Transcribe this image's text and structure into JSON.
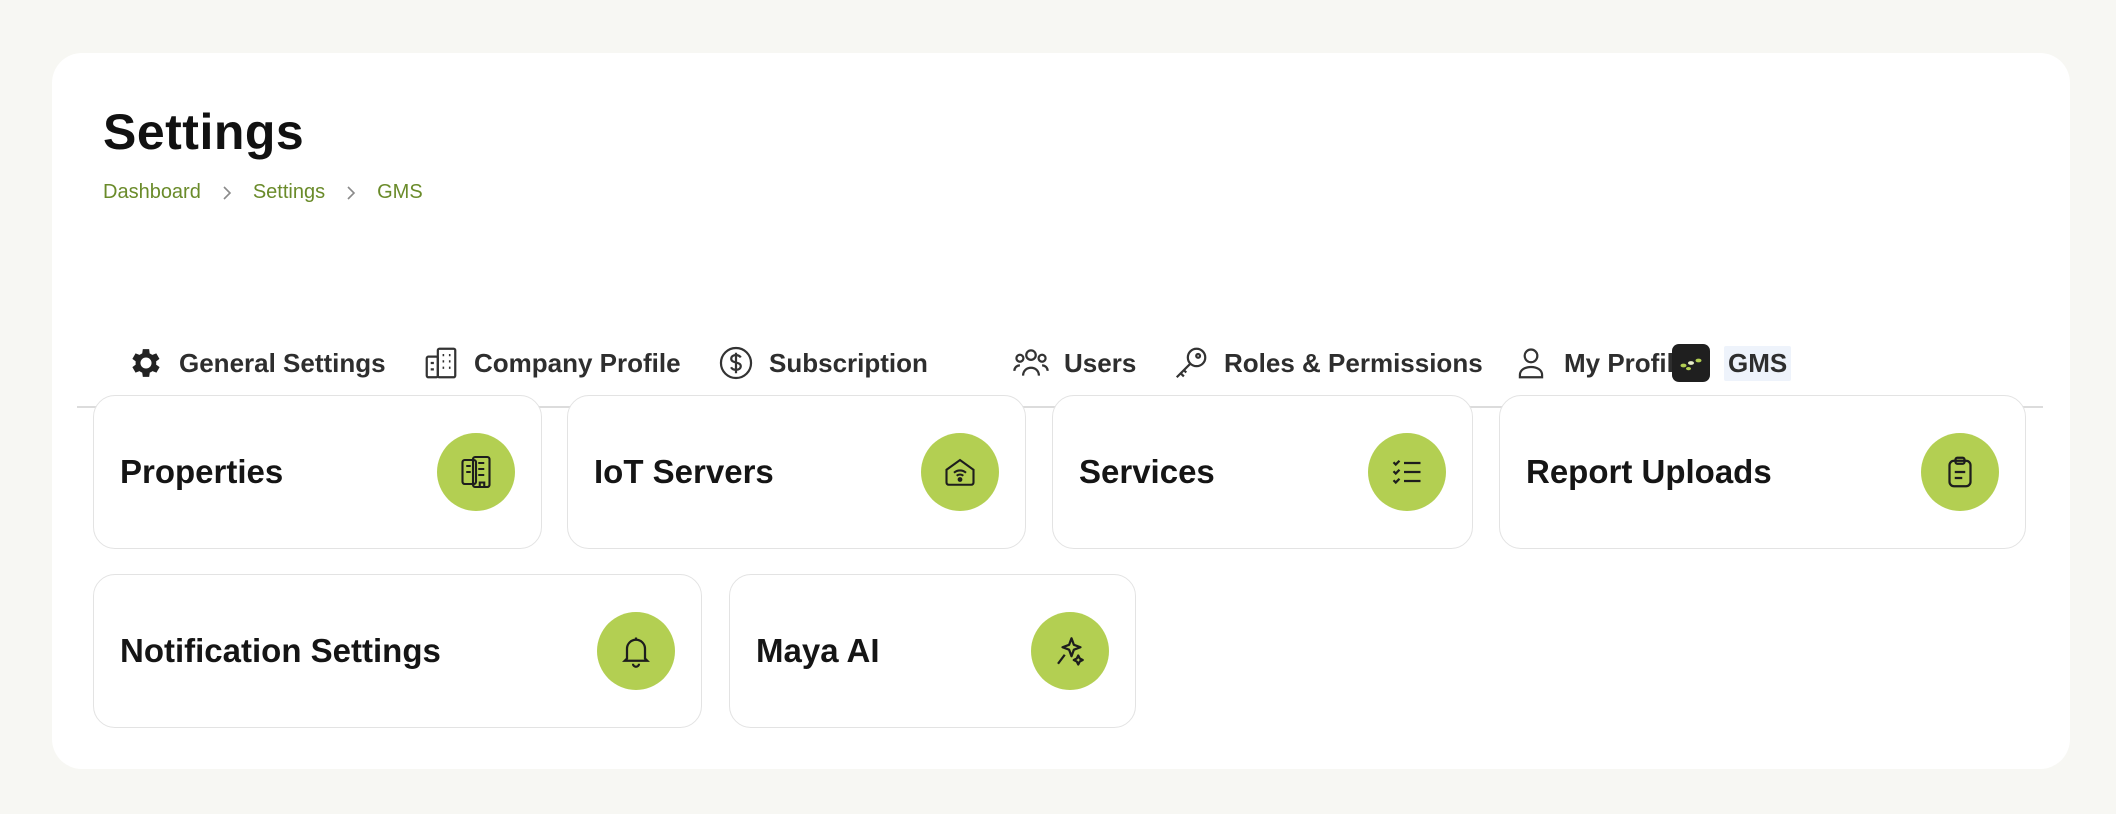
{
  "header": {
    "title": "Settings",
    "breadcrumb": [
      "Dashboard",
      "Settings",
      "GMS"
    ]
  },
  "tabs": [
    {
      "label": "General Settings",
      "icon": "gear-icon"
    },
    {
      "label": "Company Profile",
      "icon": "building-icon"
    },
    {
      "label": "Subscription",
      "icon": "dollar-circle-icon"
    },
    {
      "label": "Users",
      "icon": "users-icon"
    },
    {
      "label": "Roles & Permissions",
      "icon": "key-icon"
    },
    {
      "label": "My Profile",
      "icon": "user-icon"
    },
    {
      "label": "GMS",
      "icon": "gms-logo-icon",
      "active": true
    }
  ],
  "cards": [
    {
      "label": "Properties",
      "icon": "buildings-icon"
    },
    {
      "label": "IoT Servers",
      "icon": "wifi-house-icon"
    },
    {
      "label": "Services",
      "icon": "checklist-icon"
    },
    {
      "label": "Report Uploads",
      "icon": "clipboard-icon"
    },
    {
      "label": "Notification Settings",
      "icon": "bell-icon"
    },
    {
      "label": "Maya AI",
      "icon": "sparkle-icon"
    }
  ],
  "colors": {
    "accent": "#b3cf52",
    "breadcrumb": "#6a8b2a",
    "page_bg": "#f7f7f3",
    "panel_bg": "#ffffff"
  }
}
